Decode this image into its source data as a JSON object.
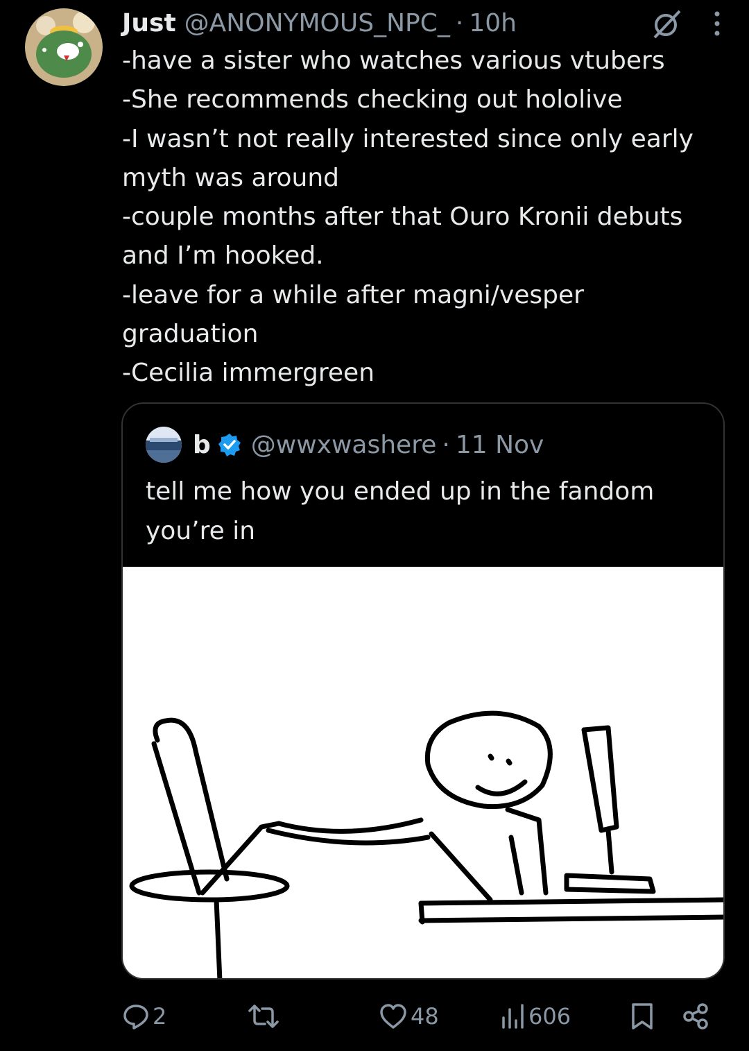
{
  "tweet": {
    "author_name": "Just",
    "author_handle": "@ANONYMOUS_NPC_",
    "separator": "·",
    "time": "10h",
    "lines": [
      "-have a sister who watches various vtubers",
      "-She recommends checking out hololive",
      "-I wasn’t not really interested since only early",
      "myth was around",
      "-couple months after that Ouro Kronii debuts",
      "and I’m hooked.",
      "-leave for a while after magni/vesper",
      "graduation",
      "-Cecilia immergreen"
    ]
  },
  "quote": {
    "author_name": "b",
    "author_handle": "@wwxwashere",
    "separator": "·",
    "date": "11 Nov",
    "text_lines": [
      "tell me how you ended up in the fandom",
      "you’re in"
    ]
  },
  "actions": {
    "replies": "2",
    "likes": "48",
    "views": "606"
  },
  "colors": {
    "background": "#000000",
    "text": "#e7e9ea",
    "muted": "#8b98a5",
    "border": "#2f3336",
    "verified": "#1d9bf0"
  },
  "icons": [
    "grok-icon",
    "more-icon",
    "reply-icon",
    "retweet-icon",
    "like-icon",
    "views-icon",
    "bookmark-icon",
    "share-icon",
    "verified-icon"
  ]
}
